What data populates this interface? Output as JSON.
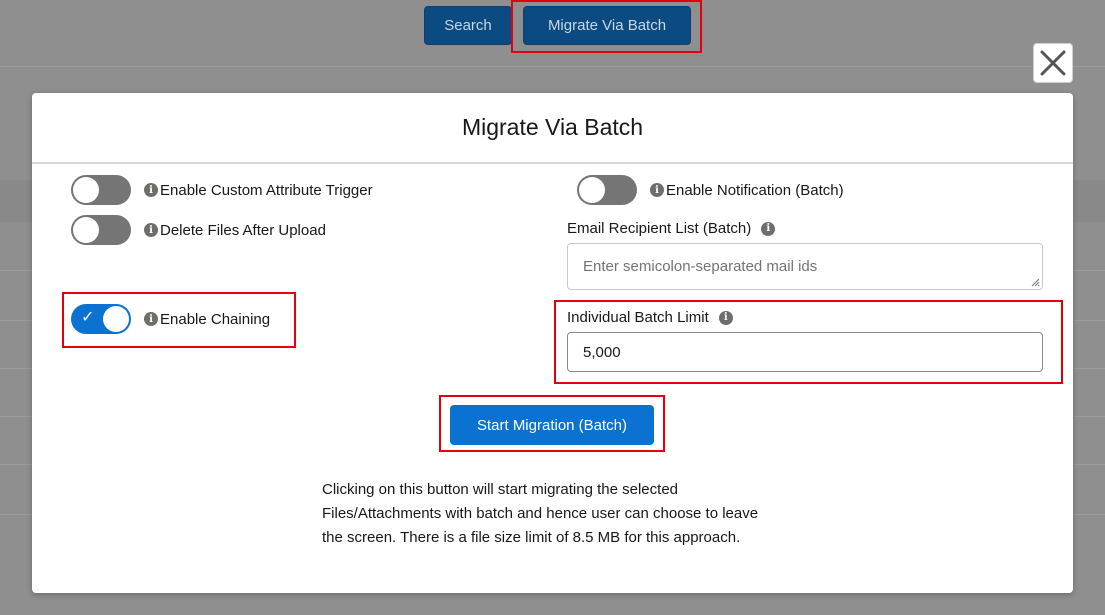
{
  "background": {
    "search_button": "Search",
    "migrate_button": "Migrate Via Batch"
  },
  "modal": {
    "title": "Migrate Via Batch",
    "close_icon": "close-icon",
    "left_toggles": [
      {
        "label": "Enable Custom Attribute Trigger",
        "on": false
      },
      {
        "label": "Delete Files After Upload",
        "on": false
      },
      {
        "label": "Enable Chaining",
        "on": true
      }
    ],
    "notification_toggle": {
      "label": "Enable Notification (Batch)",
      "on": false
    },
    "email_field": {
      "label": "Email Recipient List (Batch)",
      "placeholder": "Enter semicolon-separated mail ids",
      "value": ""
    },
    "batch_limit_field": {
      "label": "Individual Batch Limit",
      "value": "5,000"
    },
    "start_button": "Start Migration (Batch)",
    "description": "Clicking on this button will start migrating the selected Files/Attachments with batch and hence user can choose to leave the screen. There is a file size limit of 8.5 MB for this approach."
  },
  "colors": {
    "brand_blue": "#0b72d1",
    "highlight_red": "#e0000f",
    "overlay": "#8f8f8f"
  }
}
